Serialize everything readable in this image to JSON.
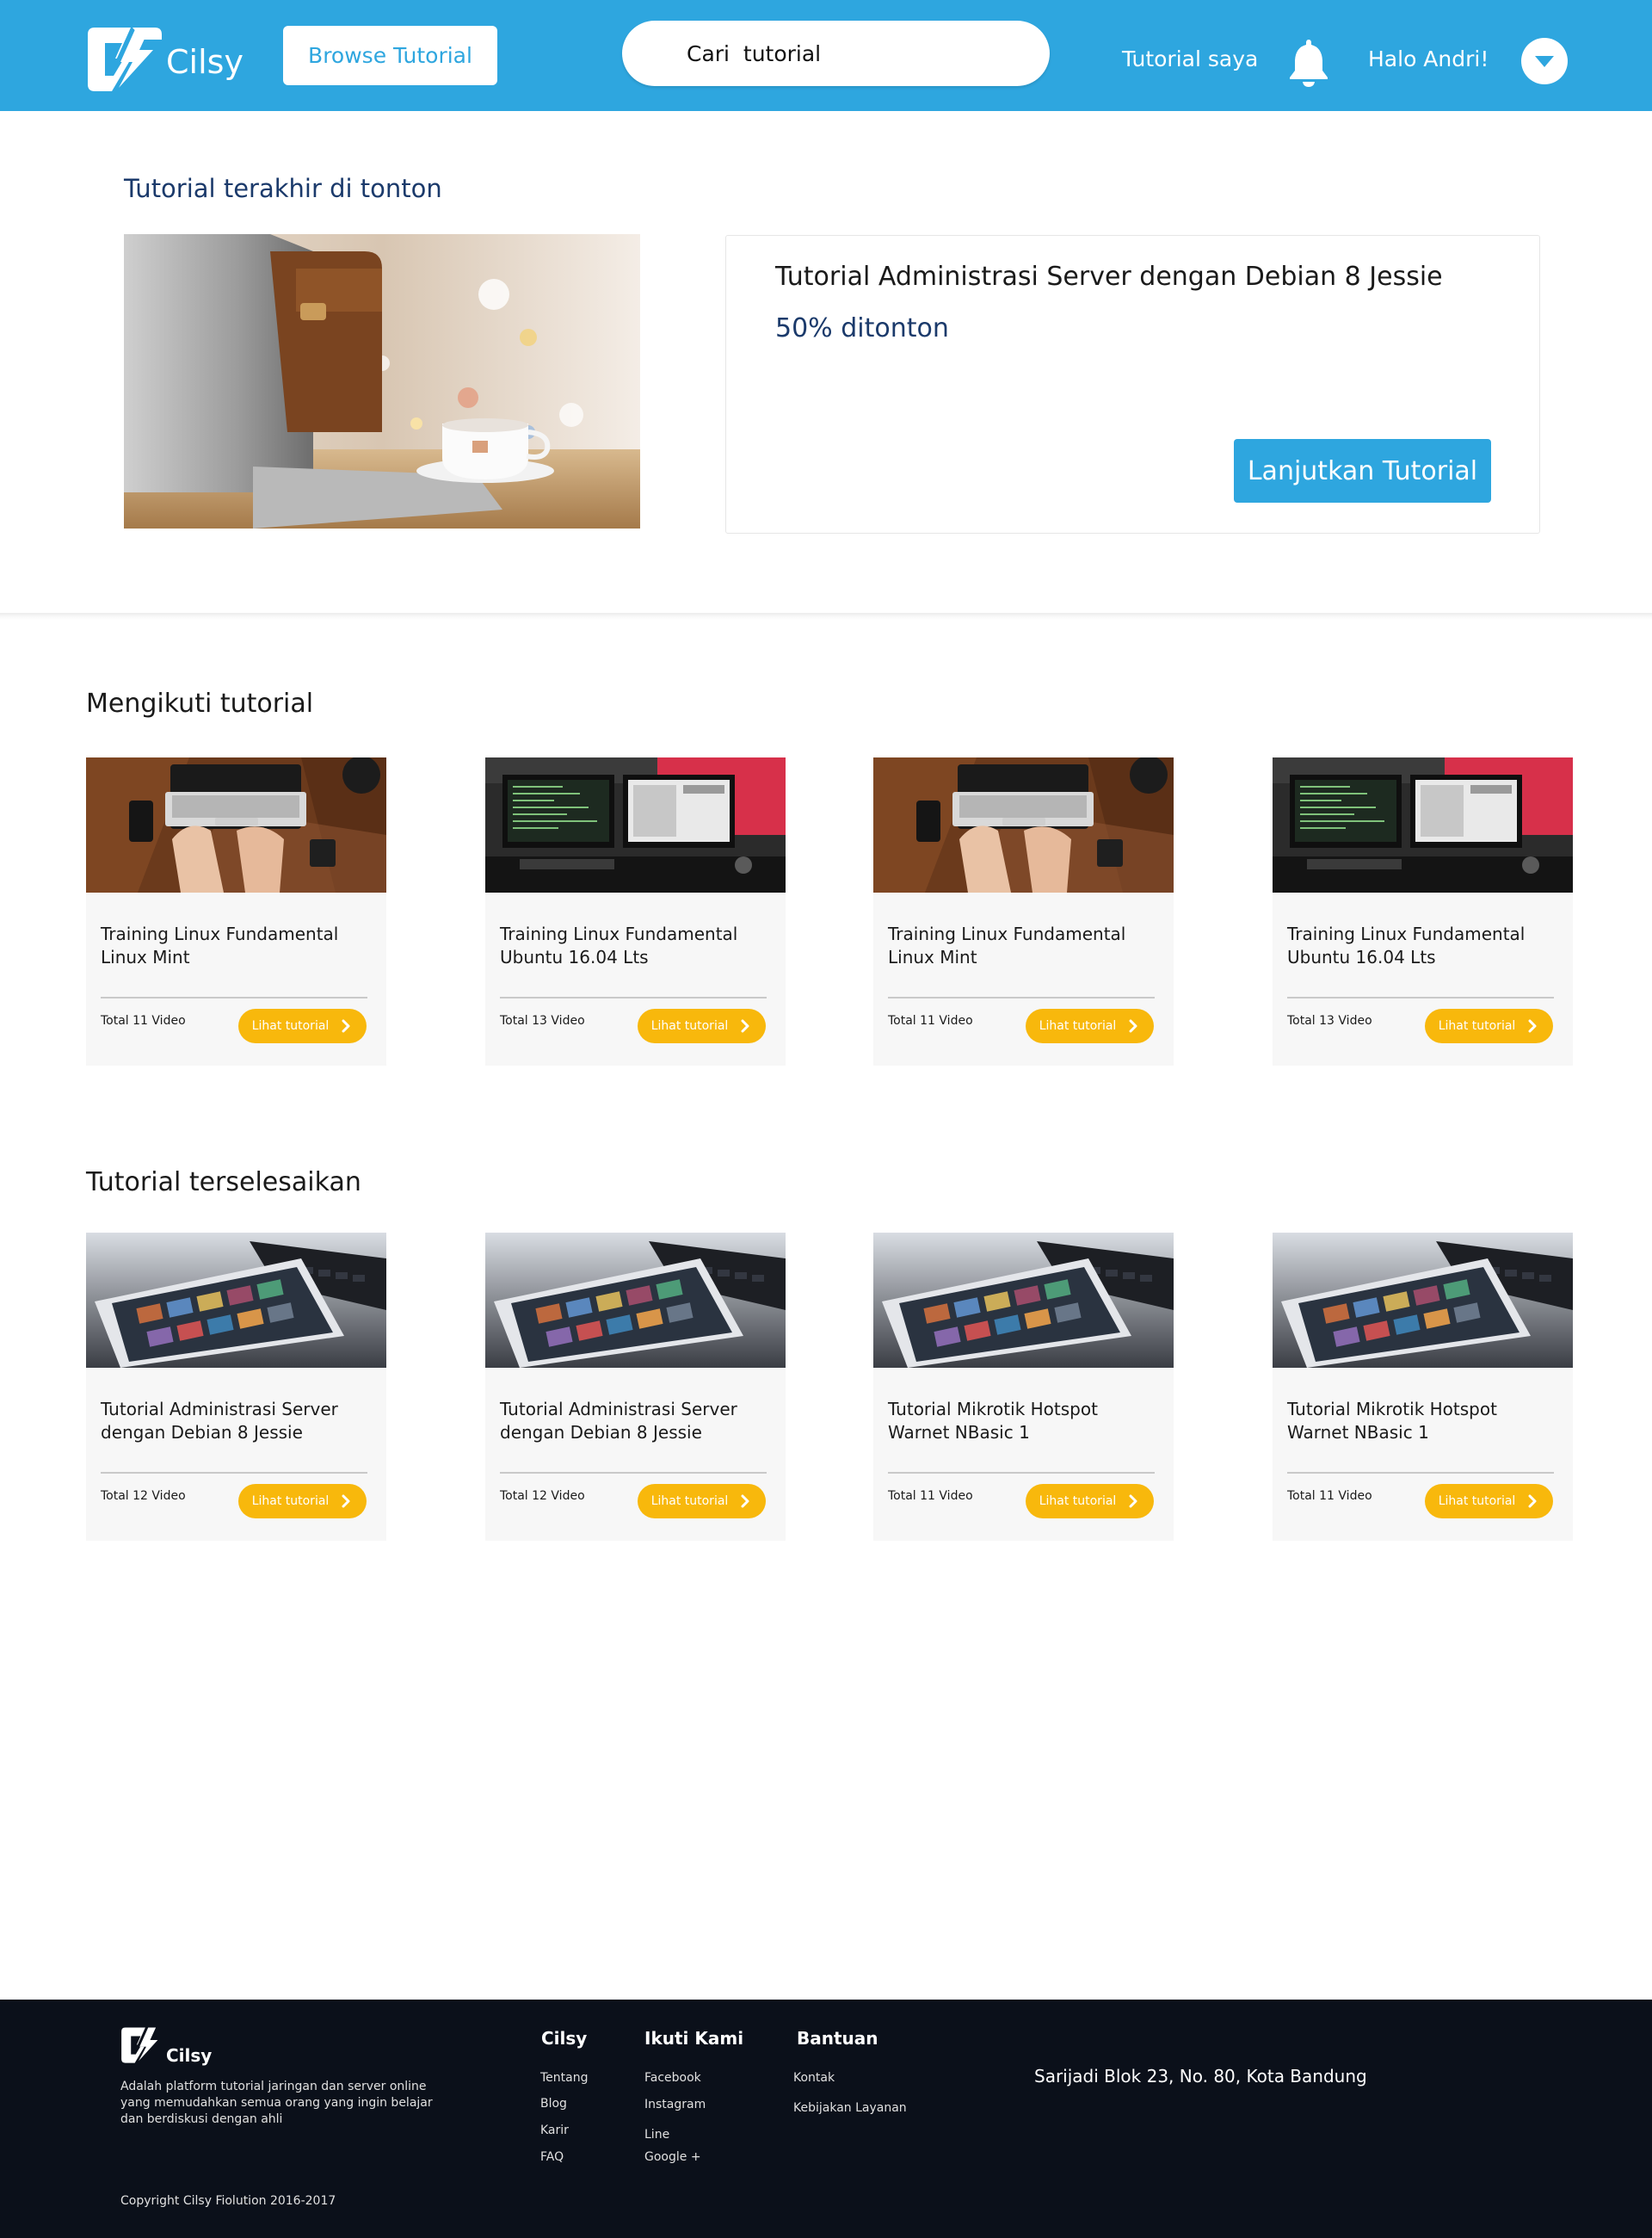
{
  "header": {
    "brand": "Cilsy",
    "browse_label": "Browse Tutorial",
    "search_placeholder": "Cari  tutorial",
    "my_tutorials_label": "Tutorial saya",
    "greeting": "Halo Andri!"
  },
  "last_watched": {
    "section_title": "Tutorial terakhir di tonton",
    "title": "Tutorial Administrasi Server dengan Debian 8 Jessie",
    "progress_text": "50% ditonton",
    "progress_value": 0.5,
    "continue_label": "Lanjutkan Tutorial"
  },
  "following": {
    "section_title": "Mengikuti tutorial",
    "cards": [
      {
        "title": "Training Linux Fundamental Linux Mint",
        "count": "Total 11 Video",
        "button": "Lihat tutorial",
        "thumb": "laptop-typing"
      },
      {
        "title": "Training Linux Fundamental Ubuntu 16.04 Lts",
        "count": "Total 13 Video",
        "button": "Lihat tutorial",
        "thumb": "monitors-desk"
      },
      {
        "title": "Training Linux Fundamental Linux Mint",
        "count": "Total 11 Video",
        "button": "Lihat tutorial",
        "thumb": "laptop-typing"
      },
      {
        "title": "Training Linux Fundamental Ubuntu 16.04 Lts",
        "count": "Total 13 Video",
        "button": "Lihat tutorial",
        "thumb": "monitors-desk"
      }
    ]
  },
  "completed": {
    "section_title": "Tutorial terselesaikan",
    "cards": [
      {
        "title": "Tutorial Administrasi Server dengan Debian 8 Jessie",
        "count": "Total 12 Video",
        "button": "Lihat tutorial",
        "thumb": "tablet-keyboard"
      },
      {
        "title": "Tutorial Administrasi Server dengan Debian 8 Jessie",
        "count": "Total 12 Video",
        "button": "Lihat tutorial",
        "thumb": "tablet-keyboard"
      },
      {
        "title": "Tutorial Mikrotik Hotspot Warnet NBasic 1",
        "count": "Total 11 Video",
        "button": "Lihat tutorial",
        "thumb": "tablet-keyboard"
      },
      {
        "title": "Tutorial Mikrotik Hotspot Warnet NBasic 1",
        "count": "Total 11 Video",
        "button": "Lihat tutorial",
        "thumb": "tablet-keyboard"
      }
    ]
  },
  "footer": {
    "brand": "Cilsy",
    "description": "Adalah platform tutorial jaringan dan server online yang memudahkan semua orang yang ingin belajar dan berdiskusi dengan ahli",
    "columns": [
      {
        "title": "Cilsy",
        "links": [
          "Tentang",
          "Blog",
          "Karir",
          "FAQ"
        ]
      },
      {
        "title": "Ikuti Kami",
        "links": [
          "Facebook",
          "Instagram",
          "Line",
          "Google +"
        ]
      },
      {
        "title": "Bantuan",
        "links": [
          "Kontak",
          "Kebijakan Layanan"
        ]
      }
    ],
    "address": "Sarijadi Blok 23, No. 80, Kota Bandung",
    "copyright": "Copyright  Cilsy Fiolution 2016-2017"
  },
  "colors": {
    "primary": "#2ea6df",
    "accent": "#f8b80c",
    "heading_blue": "#1b3a6b",
    "footer_bg": "#0b101a"
  },
  "icons": [
    "cilsy-logo-icon",
    "bell-icon",
    "chevron-down-icon",
    "chevron-right-icon"
  ]
}
